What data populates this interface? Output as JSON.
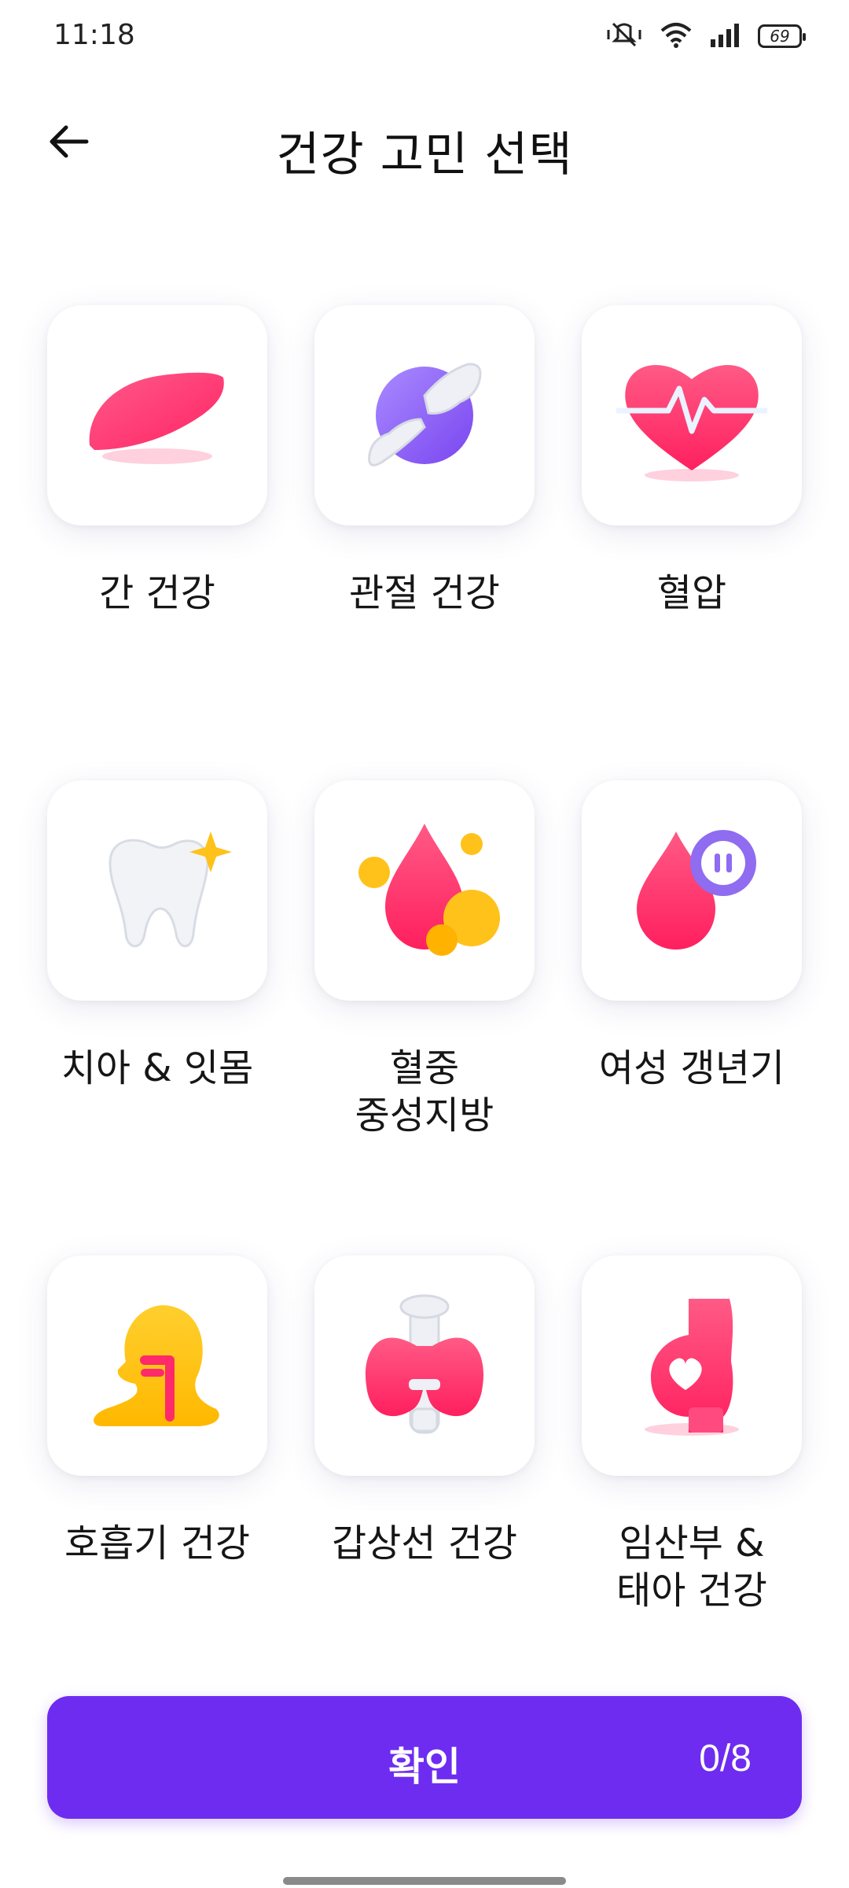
{
  "status_bar": {
    "time": "11:18",
    "battery": "69"
  },
  "header": {
    "title": "건강 고민 선택"
  },
  "categories": [
    {
      "label": "간 건강",
      "icon": "liver-icon"
    },
    {
      "label": "관절 건강",
      "icon": "joint-icon"
    },
    {
      "label": "혈압",
      "icon": "heart-pulse-icon"
    },
    {
      "label": "치아 & 잇몸",
      "icon": "tooth-icon"
    },
    {
      "label": "혈중\n중성지방",
      "icon": "blood-drop-fat-icon"
    },
    {
      "label": "여성 갱년기",
      "icon": "drop-pause-icon"
    },
    {
      "label": "호흡기 건강",
      "icon": "respiratory-icon"
    },
    {
      "label": "갑상선 건강",
      "icon": "thyroid-icon"
    },
    {
      "label": "임산부 &\n태아 건강",
      "icon": "pregnancy-icon"
    }
  ],
  "confirm": {
    "label": "확인",
    "count": "0/8"
  },
  "colors": {
    "accent": "#6e2cf0",
    "pink": "#ff3a7a",
    "yellow": "#ffc21a",
    "purple": "#8f6cf0"
  }
}
